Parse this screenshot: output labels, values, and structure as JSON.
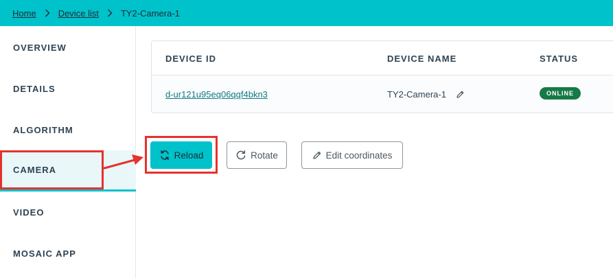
{
  "breadcrumb": {
    "home": "Home",
    "device_list": "Device list",
    "current": "TY2-Camera-1"
  },
  "sidebar": {
    "items": [
      {
        "label": "OVERVIEW"
      },
      {
        "label": "DETAILS"
      },
      {
        "label": "ALGORITHM"
      },
      {
        "label": "CAMERA",
        "active": true
      },
      {
        "label": "VIDEO"
      },
      {
        "label": "MOSAIC APP"
      }
    ]
  },
  "device_table": {
    "headers": {
      "device_id": "DEVICE ID",
      "device_name": "DEVICE NAME",
      "status": "STATUS"
    },
    "row": {
      "device_id": "d-ur121u95eq06qqf4bkn3",
      "device_name": "TY2-Camera-1",
      "status": "ONLINE"
    }
  },
  "actions": {
    "reload": "Reload",
    "rotate": "Rotate",
    "edit_coordinates": "Edit coordinates"
  },
  "colors": {
    "accent": "#00c2cb",
    "status_online": "#167a46",
    "annotation": "#e5322d"
  },
  "icons": {
    "reload": "refresh-icon",
    "rotate": "rotate-icon",
    "edit": "pencil-icon",
    "breadcrumb_separator": "chevron-right-icon"
  }
}
